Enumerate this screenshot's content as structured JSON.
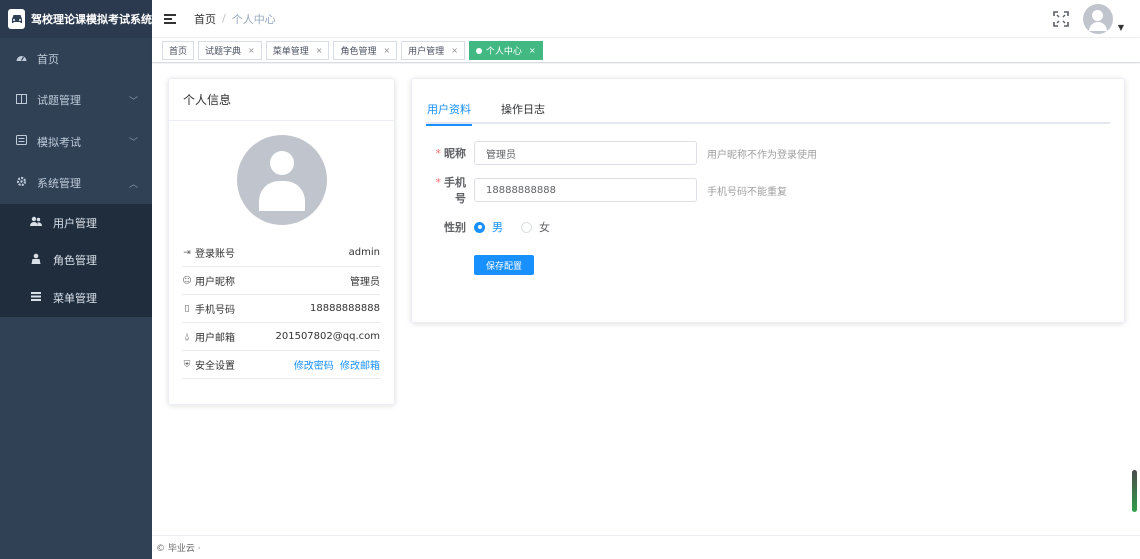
{
  "app": {
    "title": "驾校理论课模拟考试系统",
    "logo_icon": "car-icon"
  },
  "sidebar": {
    "items": [
      {
        "label": "首页",
        "icon": "dashboard-icon"
      },
      {
        "label": "试题管理",
        "icon": "book-icon",
        "expandable": true
      },
      {
        "label": "模拟考试",
        "icon": "list-icon",
        "expandable": true
      },
      {
        "label": "系统管理",
        "icon": "gear-icon",
        "expandable": true,
        "expanded": true
      }
    ],
    "submenu": [
      {
        "label": "用户管理",
        "icon": "users-icon"
      },
      {
        "label": "角色管理",
        "icon": "role-icon"
      },
      {
        "label": "菜单管理",
        "icon": "menu-icon"
      }
    ]
  },
  "header": {
    "breadcrumb_home": "首页",
    "breadcrumb_sep": "/",
    "breadcrumb_current": "个人中心"
  },
  "tags": [
    {
      "label": "首页",
      "closable": false
    },
    {
      "label": "试题字典",
      "closable": true
    },
    {
      "label": "菜单管理",
      "closable": true
    },
    {
      "label": "角色管理",
      "closable": true
    },
    {
      "label": "用户管理",
      "closable": true
    },
    {
      "label": "个人中心",
      "closable": true,
      "active": true
    }
  ],
  "tag_close": "×",
  "profile": {
    "card_title": "个人信息",
    "rows": [
      {
        "label": "登录账号",
        "value": "admin",
        "icon": "login-icon"
      },
      {
        "label": "用户昵称",
        "value": "管理员",
        "icon": "user-icon"
      },
      {
        "label": "手机号码",
        "value": "18888888888",
        "icon": "phone-icon"
      },
      {
        "label": "用户邮箱",
        "value": "201507802@qq.com",
        "icon": "email-icon"
      },
      {
        "label": "安全设置",
        "icon": "shield-icon"
      }
    ],
    "security_links": {
      "change_password": "修改密码",
      "change_email": "修改邮箱"
    }
  },
  "tabs": [
    {
      "label": "用户资料",
      "active": true
    },
    {
      "label": "操作日志",
      "active": false
    }
  ],
  "form": {
    "nickname_label": "昵称",
    "nickname_value": "管理员",
    "nickname_hint": "用户昵称不作为登录使用",
    "phone_label": "手机号",
    "phone_value": "18888888888",
    "phone_hint": "手机号码不能重复",
    "gender_label": "性别",
    "gender_options": [
      {
        "label": "男",
        "checked": true
      },
      {
        "label": "女",
        "checked": false
      }
    ],
    "required_mark": "*",
    "save_label": "保存配置"
  },
  "footer": {
    "text": "© 毕业云 ·"
  },
  "colors": {
    "sidebar_bg": "#304156",
    "primary": "#1890ff",
    "active_tag": "#42b983"
  }
}
